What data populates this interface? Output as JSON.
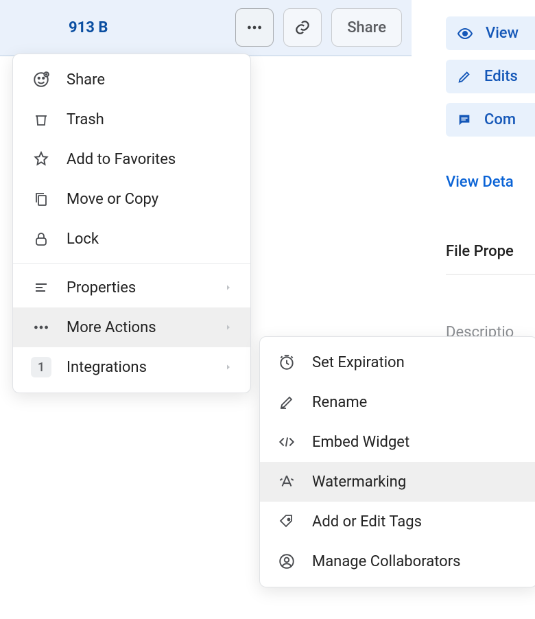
{
  "topbar": {
    "file_size": "913 B",
    "share_label": "Share"
  },
  "sidebar": {
    "chips": [
      {
        "icon": "eye-icon",
        "label": "View"
      },
      {
        "icon": "pencil-icon",
        "label": "Edits"
      },
      {
        "icon": "comment-icon",
        "label": "Com"
      }
    ],
    "view_details": "View Deta",
    "section_title": "File Prope",
    "description_label": "Descriptio"
  },
  "menu": {
    "items": [
      {
        "icon": "add-person-icon",
        "label": "Share"
      },
      {
        "icon": "trash-icon",
        "label": "Trash"
      },
      {
        "icon": "star-icon",
        "label": "Add to Favorites"
      },
      {
        "icon": "copy-icon",
        "label": "Move or Copy"
      },
      {
        "icon": "lock-icon",
        "label": "Lock"
      }
    ],
    "sub_items": [
      {
        "icon": "properties-icon",
        "label": "Properties",
        "has_sub": true
      },
      {
        "icon": "more-icon",
        "label": "More Actions",
        "has_sub": true,
        "hover": true
      },
      {
        "icon": "badge",
        "badge": "1",
        "label": "Integrations",
        "has_sub": true
      }
    ]
  },
  "submenu": {
    "items": [
      {
        "icon": "clock-icon",
        "label": "Set Expiration"
      },
      {
        "icon": "rename-icon",
        "label": "Rename"
      },
      {
        "icon": "code-icon",
        "label": "Embed Widget"
      },
      {
        "icon": "watermark-icon",
        "label": "Watermarking",
        "hover": true
      },
      {
        "icon": "tag-icon",
        "label": "Add or Edit Tags"
      },
      {
        "icon": "user-circle-icon",
        "label": "Manage Collaborators"
      }
    ]
  }
}
